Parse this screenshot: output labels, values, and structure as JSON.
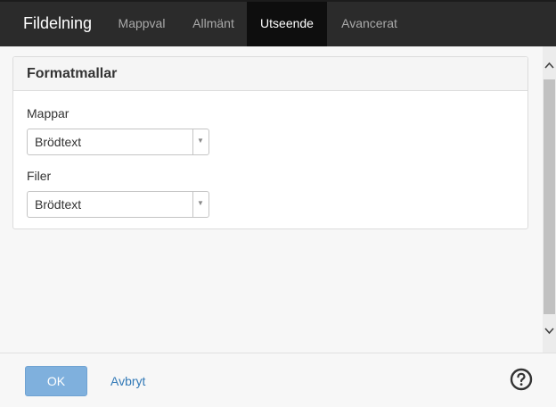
{
  "app": {
    "title": "Fildelning"
  },
  "tabs": [
    {
      "label": "Mappval",
      "active": false
    },
    {
      "label": "Allmänt",
      "active": false
    },
    {
      "label": "Utseende",
      "active": true
    },
    {
      "label": "Avancerat",
      "active": false
    }
  ],
  "panel": {
    "title": "Formatmallar",
    "fields": [
      {
        "label": "Mappar",
        "value": "Brödtext"
      },
      {
        "label": "Filer",
        "value": "Brödtext"
      }
    ]
  },
  "footer": {
    "ok_label": "OK",
    "cancel_label": "Avbryt",
    "help_icon": "question-circle-icon"
  },
  "colors": {
    "topbar": "#2b2b2b",
    "active_tab": "#0e0e0e",
    "primary_button": "#7fb0dd",
    "link": "#337ab7"
  }
}
